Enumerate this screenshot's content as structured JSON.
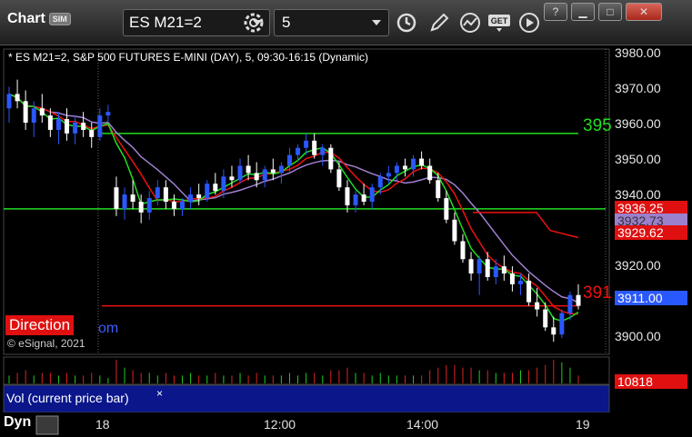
{
  "toolbar": {
    "app_title": "Chart",
    "sim_badge": "SIM",
    "symbol": "ES M21=2",
    "interval": "5"
  },
  "chart": {
    "header": "* ES M21=2, S&P 500 FUTURES E-MINI (DAY), 5, 09:30-16:15 (Dynamic)",
    "copyright": "© eSignal, 2021",
    "direction_label": "Direction",
    "direction_suffix": "om",
    "price_ticks": [
      "3980.00",
      "3970.00",
      "3960.00",
      "3950.00",
      "3940.00",
      "3920.00",
      "3900.00"
    ],
    "price_tags": {
      "red_upper": "3936.25",
      "purple": "3932.73",
      "red_lower": "3929.62",
      "last": "3911.00",
      "volume": "10818"
    },
    "line_labels": {
      "green": "395",
      "red": "391"
    },
    "time_ticks": [
      "18",
      "12:00",
      "14:00",
      "19"
    ],
    "vol_label": "Vol (current price bar)",
    "vol_close": "×",
    "dyn_label": "Dyn",
    "colors": {
      "up": "#2a58ff",
      "down": "#ffffff",
      "green_line": "#22dd22",
      "red_line": "#ee1111",
      "purple_line": "#a080d0"
    }
  },
  "chart_data": {
    "type": "candlestick",
    "ylim": [
      3898,
      3982
    ],
    "candles": [
      [
        3966,
        3972,
        3962,
        3970
      ],
      [
        3970,
        3974,
        3966,
        3968
      ],
      [
        3968,
        3971,
        3960,
        3962
      ],
      [
        3962,
        3968,
        3958,
        3966
      ],
      [
        3966,
        3970,
        3962,
        3964
      ],
      [
        3964,
        3966,
        3958,
        3960
      ],
      [
        3960,
        3965,
        3956,
        3963
      ],
      [
        3963,
        3966,
        3957,
        3959
      ],
      [
        3959,
        3964,
        3956,
        3962
      ],
      [
        3962,
        3965,
        3958,
        3960
      ],
      [
        3960,
        3962,
        3955,
        3958
      ],
      [
        3958,
        3966,
        3957,
        3964
      ],
      [
        3964,
        3967,
        3962,
        3965
      ],
      [
        3944,
        3947,
        3936,
        3938
      ],
      [
        3938,
        3944,
        3935,
        3942
      ],
      [
        3942,
        3946,
        3938,
        3940
      ],
      [
        3940,
        3942,
        3934,
        3937
      ],
      [
        3937,
        3943,
        3935,
        3941
      ],
      [
        3941,
        3946,
        3939,
        3944
      ],
      [
        3944,
        3946,
        3938,
        3940
      ],
      [
        3940,
        3942,
        3936,
        3938
      ],
      [
        3938,
        3941,
        3936,
        3940
      ],
      [
        3940,
        3944,
        3938,
        3942
      ],
      [
        3942,
        3945,
        3939,
        3941
      ],
      [
        3941,
        3946,
        3940,
        3945
      ],
      [
        3945,
        3948,
        3942,
        3943
      ],
      [
        3943,
        3949,
        3941,
        3947
      ],
      [
        3947,
        3950,
        3944,
        3946
      ],
      [
        3946,
        3952,
        3945,
        3950
      ],
      [
        3950,
        3953,
        3946,
        3948
      ],
      [
        3948,
        3951,
        3944,
        3946
      ],
      [
        3946,
        3950,
        3944,
        3949
      ],
      [
        3949,
        3952,
        3946,
        3948
      ],
      [
        3948,
        3951,
        3945,
        3950
      ],
      [
        3950,
        3955,
        3948,
        3953
      ],
      [
        3953,
        3956,
        3951,
        3955
      ],
      [
        3955,
        3959,
        3953,
        3957
      ],
      [
        3957,
        3959,
        3952,
        3953
      ],
      [
        3953,
        3956,
        3950,
        3955
      ],
      [
        3955,
        3956,
        3948,
        3949
      ],
      [
        3949,
        3951,
        3943,
        3944
      ],
      [
        3944,
        3946,
        3937,
        3939
      ],
      [
        3939,
        3943,
        3937,
        3942
      ],
      [
        3942,
        3945,
        3939,
        3940
      ],
      [
        3940,
        3945,
        3938,
        3944
      ],
      [
        3944,
        3948,
        3942,
        3947
      ],
      [
        3947,
        3950,
        3945,
        3948
      ],
      [
        3948,
        3951,
        3946,
        3950
      ],
      [
        3950,
        3952,
        3947,
        3949
      ],
      [
        3949,
        3953,
        3947,
        3952
      ],
      [
        3952,
        3954,
        3949,
        3950
      ],
      [
        3950,
        3952,
        3945,
        3946
      ],
      [
        3946,
        3948,
        3940,
        3941
      ],
      [
        3941,
        3943,
        3934,
        3935
      ],
      [
        3935,
        3937,
        3928,
        3929
      ],
      [
        3929,
        3931,
        3923,
        3924
      ],
      [
        3924,
        3926,
        3918,
        3920
      ],
      [
        3920,
        3925,
        3914,
        3924
      ],
      [
        3924,
        3926,
        3918,
        3919
      ],
      [
        3919,
        3924,
        3917,
        3922
      ],
      [
        3922,
        3925,
        3918,
        3920
      ],
      [
        3920,
        3922,
        3915,
        3917
      ],
      [
        3917,
        3920,
        3914,
        3918
      ],
      [
        3918,
        3920,
        3911,
        3912
      ],
      [
        3912,
        3916,
        3908,
        3910
      ],
      [
        3910,
        3912,
        3904,
        3905
      ],
      [
        3905,
        3908,
        3901,
        3903
      ],
      [
        3903,
        3910,
        3902,
        3909
      ],
      [
        3909,
        3915,
        3907,
        3914
      ],
      [
        3914,
        3917,
        3910,
        3911
      ]
    ],
    "volume": [
      3,
      4,
      5,
      3,
      4,
      4,
      3,
      4,
      3,
      3,
      4,
      3,
      2,
      9,
      6,
      5,
      4,
      4,
      3,
      4,
      3,
      3,
      4,
      3,
      3,
      4,
      3,
      3,
      4,
      3,
      4,
      3,
      3,
      3,
      4,
      3,
      4,
      4,
      3,
      5,
      5,
      6,
      4,
      4,
      3,
      4,
      3,
      3,
      3,
      3,
      3,
      5,
      6,
      7,
      7,
      6,
      6,
      5,
      5,
      4,
      4,
      4,
      5,
      5,
      6,
      7,
      9,
      8,
      6,
      3
    ]
  }
}
